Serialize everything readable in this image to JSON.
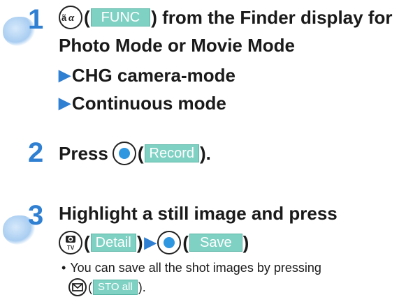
{
  "step1": {
    "num": "1",
    "paren_open": "(",
    "softkey": "FUNC",
    "text_after": ") from the Finder display for",
    "line2": "Photo Mode or Movie Mode",
    "options": [
      "CHG camera-mode",
      "Continuous mode"
    ]
  },
  "step2": {
    "num": "2",
    "text_before": "Press",
    "paren_open": "(",
    "softkey": "Record",
    "paren_close": ")."
  },
  "step3": {
    "num": "3",
    "line1": "Highlight a still image and press",
    "paren_open": "(",
    "softkey1": "Detail",
    "paren_close1": ")",
    "paren_open2": "(",
    "softkey2": "Save",
    "paren_close2": ")",
    "bullet": "You can save all the shot images by pressing",
    "paren_open3": "(",
    "softkey3": "STO all",
    "paren_close3": ")."
  },
  "icons": {
    "func_key": "func-key-icon",
    "center_key": "center-key-icon",
    "camera_key": "camera-tv-key-icon",
    "mail_key": "mail-key-icon",
    "arrow": "right-triangle-arrow-icon"
  },
  "colors": {
    "accent": "#2f7fd2",
    "softkey": "#7fd1c3"
  }
}
